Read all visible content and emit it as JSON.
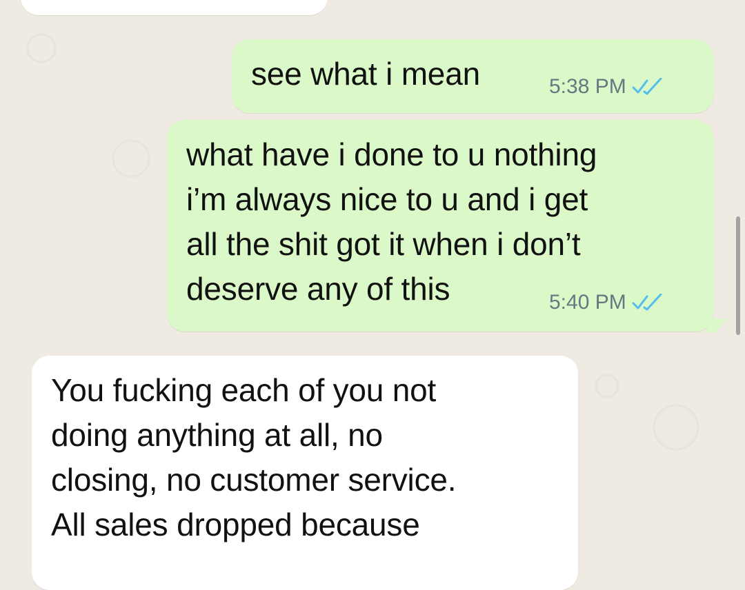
{
  "messages": [
    {
      "text": "see what i mean",
      "time": "5:38 PM",
      "status_icon": "double-check-read-icon"
    },
    {
      "text": "what have i done to u nothing\ni’m always nice to u and i get\nall the shit got it when i don’t\ndeserve any of this",
      "time": "5:40 PM",
      "status_icon": "double-check-read-icon"
    },
    {
      "text": "You fucking each of you not\ndoing anything at all, no\nclosing, no customer service.\nAll sales dropped because"
    }
  ],
  "colors": {
    "background": "#efeae2",
    "outgoing_bubble": "#dbf8c8",
    "incoming_bubble": "#ffffff",
    "read_ticks": "#53bdeb",
    "timestamp": "#667781"
  }
}
